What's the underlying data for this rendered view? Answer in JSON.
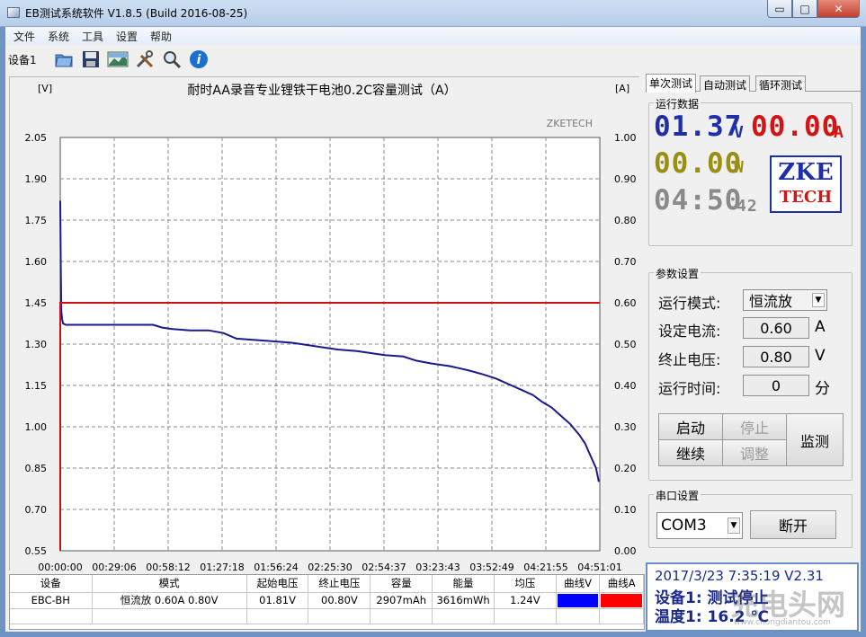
{
  "window": {
    "title": "EB测试系统软件 V1.8.5 (Build 2016-08-25)",
    "controls": {
      "minimize": "▭",
      "maximize": "□",
      "close": "✕"
    }
  },
  "menu": [
    "文件",
    "系统",
    "工具",
    "设置",
    "帮助"
  ],
  "toolbar": {
    "device_label": "设备1",
    "icons": [
      "open-folder-icon",
      "save-icon",
      "chart-image-icon",
      "tools-icon",
      "zoom-icon",
      "info-icon"
    ],
    "colors": {
      "info": "#1a6fd1"
    }
  },
  "chart_data": {
    "type": "line",
    "title": "耐时AA录音专业锂铁干电池0.2C容量测试（A）",
    "watermark": "ZKETECH",
    "left_unit": "[V]",
    "right_unit": "[A]",
    "y_left_ticks": [
      "0.55",
      "0.70",
      "0.85",
      "1.00",
      "1.15",
      "1.30",
      "1.45",
      "1.60",
      "1.75",
      "1.90",
      "2.05"
    ],
    "y_right_ticks": [
      "0.00",
      "0.10",
      "0.20",
      "0.30",
      "0.40",
      "0.50",
      "0.60",
      "0.70",
      "0.80",
      "0.90",
      "1.00"
    ],
    "x_ticks": [
      "00:00:00",
      "00:29:06",
      "00:58:12",
      "01:27:18",
      "01:56:24",
      "02:25:30",
      "02:54:37",
      "03:23:43",
      "03:52:49",
      "04:21:55",
      "04:51:01"
    ],
    "ylim_left": [
      0.55,
      2.05
    ],
    "ylim_right": [
      0,
      1.0
    ],
    "x_range_minutes": [
      0,
      291.02
    ],
    "grid": true,
    "series": [
      {
        "axis": "left",
        "color": "#1a1a8c",
        "x": [
          0,
          0.3,
          0.6,
          1,
          1.5,
          3,
          5,
          10,
          20,
          30,
          40,
          50,
          55,
          60,
          70,
          80,
          88,
          95,
          105,
          115,
          125,
          130,
          140,
          150,
          160,
          165,
          175,
          185,
          192,
          200,
          210,
          220,
          228,
          235,
          240,
          245,
          250,
          255,
          260,
          265,
          270,
          275,
          280,
          283,
          285,
          287,
          289,
          290.5
        ],
        "values": [
          1.82,
          1.58,
          1.42,
          1.39,
          1.375,
          1.37,
          1.37,
          1.37,
          1.37,
          1.37,
          1.37,
          1.37,
          1.36,
          1.355,
          1.35,
          1.35,
          1.34,
          1.32,
          1.315,
          1.31,
          1.305,
          1.3,
          1.29,
          1.28,
          1.275,
          1.27,
          1.26,
          1.255,
          1.24,
          1.23,
          1.22,
          1.205,
          1.19,
          1.175,
          1.16,
          1.145,
          1.13,
          1.115,
          1.09,
          1.07,
          1.04,
          1.01,
          0.97,
          0.94,
          0.91,
          0.88,
          0.85,
          0.8
        ]
      },
      {
        "axis": "right",
        "color": "#cc1111",
        "x": [
          0,
          0,
          0.8,
          291.02
        ],
        "values": [
          0,
          0.6,
          0.6,
          0.6
        ]
      }
    ]
  },
  "table": {
    "headers": [
      "设备",
      "模式",
      "起始电压",
      "终止电压",
      "容量",
      "能量",
      "均压",
      "曲线V",
      "曲线A"
    ],
    "rows": [
      {
        "device": "EBC-BH",
        "mode": "恒流放  0.60A  0.80V",
        "start_v": "01.81V",
        "end_v": "00.80V",
        "capacity": "2907mAh",
        "energy": "3616mWh",
        "avg_v": "1.24V",
        "curve_v_color": "#0000ff",
        "curve_a_color": "#ff0000"
      }
    ]
  },
  "right": {
    "tabs": [
      "单次测试",
      "自动测试",
      "循环测试"
    ],
    "run_data": {
      "label": "运行数据",
      "voltage": "01.37",
      "voltage_unit": "V",
      "current": "00.00",
      "current_unit": "A",
      "power": "00.00",
      "power_unit": "W",
      "time_main": "04:50",
      "time_sec": "42",
      "logo_line1": "ZKE",
      "logo_line2": "TECH",
      "colors": {
        "voltage": "#1e2fa8",
        "current": "#d11515",
        "power": "#9a8f12",
        "time": "#8a8a8a"
      }
    },
    "params": {
      "label": "参数设置",
      "mode_label": "运行模式:",
      "mode_value": "恒流放",
      "current_label": "设定电流:",
      "current_value": "0.60",
      "current_unit": "A",
      "cutoff_label": "终止电压:",
      "cutoff_value": "0.80",
      "cutoff_unit": "V",
      "time_label": "运行时间:",
      "time_value": "0",
      "time_unit": "分"
    },
    "buttons": {
      "start": "启动",
      "stop": "停止",
      "continue": "继续",
      "adjust": "调整",
      "monitor": "监测"
    },
    "serial": {
      "label": "串口设置",
      "port": "COM3",
      "disconnect": "断开"
    },
    "status": {
      "datetime_version": "2017/3/23 7:35:19  V2.31",
      "device_status": "设备1: 测试停止",
      "temperature": "温度1: 16.2 ℃"
    },
    "watermark": {
      "text": "充电头网",
      "url": "www.chongdiantou.com"
    }
  }
}
